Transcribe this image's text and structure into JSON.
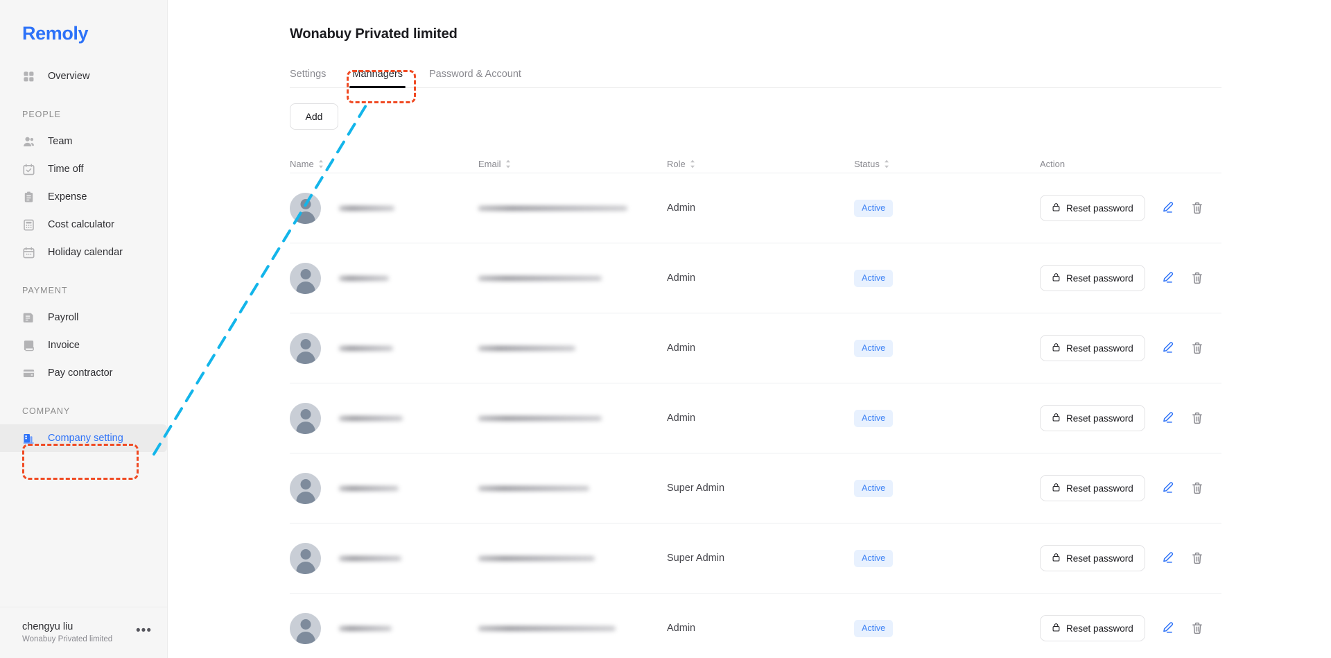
{
  "brand": {
    "name": "Remoly"
  },
  "sidebar": {
    "overview": {
      "label": "Overview",
      "icon": "grid-icon"
    },
    "sections": [
      {
        "label": "PEOPLE",
        "items": [
          {
            "label": "Team",
            "icon": "people-icon"
          },
          {
            "label": "Time off",
            "icon": "calendar-check-icon"
          },
          {
            "label": "Expense",
            "icon": "clipboard-icon"
          },
          {
            "label": "Cost calculator",
            "icon": "calculator-icon"
          },
          {
            "label": "Holiday calendar",
            "icon": "calendar-icon"
          }
        ]
      },
      {
        "label": "PAYMENT",
        "items": [
          {
            "label": "Payroll",
            "icon": "document-list-icon"
          },
          {
            "label": "Invoice",
            "icon": "invoice-icon"
          },
          {
            "label": "Pay contractor",
            "icon": "credit-card-icon"
          }
        ]
      },
      {
        "label": "COMPANY",
        "items": [
          {
            "label": "Company setting",
            "icon": "building-icon",
            "active": true
          }
        ]
      }
    ],
    "user": {
      "name": "chengyu liu",
      "org": "Wonabuy Privated limited",
      "menu": "•••"
    }
  },
  "main": {
    "title": "Wonabuy Privated limited",
    "tabs": [
      {
        "label": "Settings",
        "active": false
      },
      {
        "label": "Mannagers",
        "active": true
      },
      {
        "label": "Password & Account",
        "active": false
      }
    ],
    "add_button": "Add",
    "table": {
      "columns": [
        {
          "key": "name",
          "label": "Name",
          "sortable": true
        },
        {
          "key": "email",
          "label": "Email",
          "sortable": true
        },
        {
          "key": "role",
          "label": "Role",
          "sortable": true
        },
        {
          "key": "status",
          "label": "Status",
          "sortable": true
        },
        {
          "key": "action",
          "label": "Action",
          "sortable": false
        }
      ],
      "rows": [
        {
          "name": "",
          "name_redacted": true,
          "name_width": 80,
          "email": "",
          "email_redacted": true,
          "email_width": 215,
          "role": "Admin",
          "status": "Active",
          "reset": "Reset password"
        },
        {
          "name": "",
          "name_redacted": true,
          "name_width": 72,
          "email": "",
          "email_redacted": true,
          "email_width": 178,
          "role": "Admin",
          "status": "Active",
          "reset": "Reset password"
        },
        {
          "name": "",
          "name_redacted": true,
          "name_width": 78,
          "email": "",
          "email_redacted": true,
          "email_width": 140,
          "role": "Admin",
          "status": "Active",
          "reset": "Reset password"
        },
        {
          "name": "",
          "name_redacted": true,
          "name_width": 92,
          "email": "",
          "email_redacted": true,
          "email_width": 178,
          "role": "Admin",
          "status": "Active",
          "reset": "Reset password"
        },
        {
          "name": "",
          "name_redacted": true,
          "name_width": 86,
          "email": "",
          "email_redacted": true,
          "email_width": 160,
          "role": "Super Admin",
          "status": "Active",
          "reset": "Reset password"
        },
        {
          "name": "",
          "name_redacted": true,
          "name_width": 90,
          "email": "",
          "email_redacted": true,
          "email_width": 168,
          "role": "Super Admin",
          "status": "Active",
          "reset": "Reset password"
        },
        {
          "name": "",
          "name_redacted": true,
          "name_width": 76,
          "email": "",
          "email_redacted": true,
          "email_width": 198,
          "role": "Admin",
          "status": "Active",
          "reset": "Reset password"
        }
      ],
      "row_icons": {
        "edit": "pencil-icon",
        "delete": "trash-icon",
        "reset": "lock-icon"
      }
    }
  },
  "annotations": {
    "highlight_color": "#f04a23",
    "arrow_color": "#13b5ea",
    "boxes": [
      {
        "target": "tab-mannagers"
      },
      {
        "target": "sidebar-item-company-setting"
      }
    ],
    "arrow": {
      "from": "sidebar-item-company-setting",
      "to": "tab-mannagers"
    }
  }
}
